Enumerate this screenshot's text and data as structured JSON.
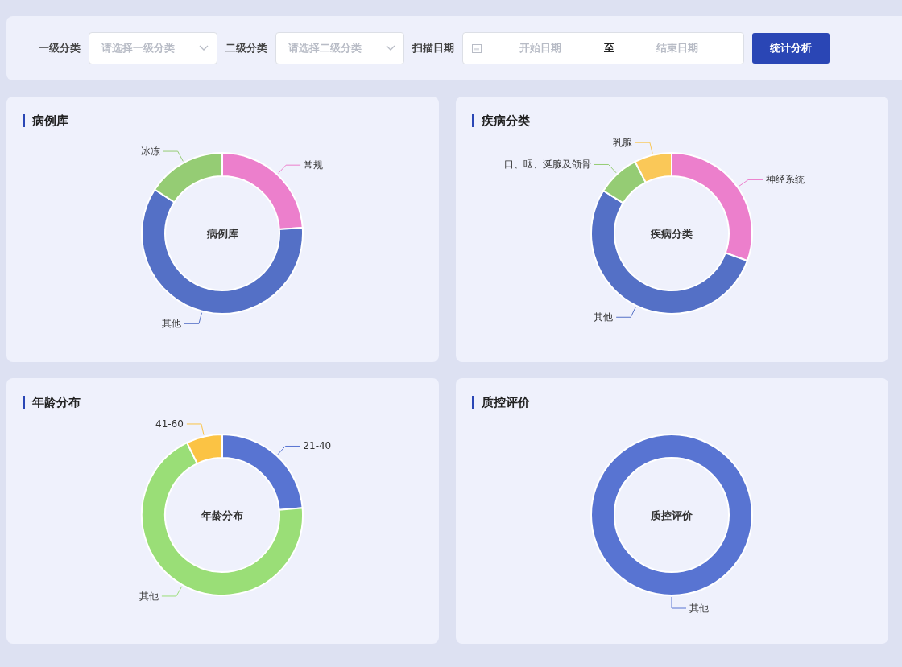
{
  "filters": [
    {
      "kind": "select",
      "label": "一级分类",
      "placeholder": "请选择一级分类"
    },
    {
      "kind": "select",
      "label": "二级分类",
      "placeholder": "请选择二级分类"
    },
    {
      "kind": "daterange",
      "label": "扫描日期",
      "start_placeholder": "开始日期",
      "separator": "至",
      "end_placeholder": "结束日期"
    }
  ],
  "submit_button": "统计分析",
  "charts": [
    {
      "title": "病例库",
      "center_label": "病例库",
      "slices": [
        {
          "label": "常规",
          "color": "#ec7fcc"
        },
        {
          "label": "其他",
          "color": "#5470c6"
        },
        {
          "label": "冰冻",
          "color": "#95cc74"
        }
      ]
    },
    {
      "title": "疾病分类",
      "center_label": "疾病分类",
      "slices": [
        {
          "label": "神经系统",
          "color": "#ec7fcc"
        },
        {
          "label": "其他",
          "color": "#5470c6"
        },
        {
          "label": "口、咽、涎腺及颌骨",
          "color": "#95cc74"
        },
        {
          "label": "乳腺",
          "color": "#fac858"
        }
      ]
    },
    {
      "title": "年龄分布",
      "center_label": "年龄分布",
      "slices": [
        {
          "label": "21-40",
          "color": "#5874d2"
        },
        {
          "label": "其他",
          "color": "#9ade77"
        },
        {
          "label": "41-60",
          "color": "#fbc344"
        }
      ]
    },
    {
      "title": "质控评价",
      "center_label": "质控评价",
      "slices": [
        {
          "label": "其他",
          "color": "#5874d2"
        }
      ]
    }
  ]
}
